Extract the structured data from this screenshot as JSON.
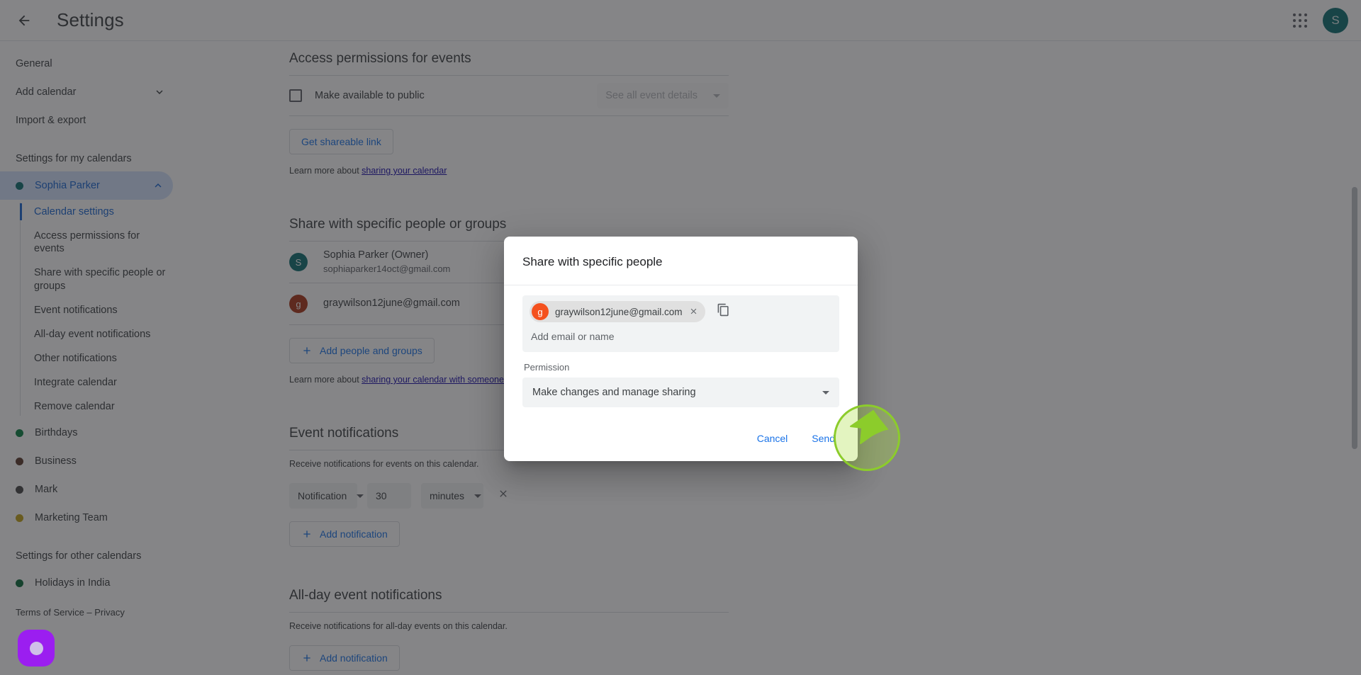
{
  "appbar": {
    "back_icon": "arrow-left-icon",
    "title": "Settings",
    "apps_icon": "apps-grid-icon",
    "avatar_initial": "S"
  },
  "sidebar": {
    "top_items": [
      {
        "label": "General",
        "icon": null
      },
      {
        "label": "Add calendar",
        "icon": "chevron-down-icon"
      },
      {
        "label": "Import & export",
        "icon": null
      }
    ],
    "my_calendars_label": "Settings for my calendars",
    "my_calendar": {
      "name": "Sophia Parker",
      "color": "#0f6f72",
      "expanded_icon": "chevron-up-icon",
      "sub_items": [
        {
          "label": "Calendar settings",
          "active": true
        },
        {
          "label": "Access permissions for events",
          "active": false
        },
        {
          "label": "Share with specific people or groups",
          "active": false
        },
        {
          "label": "Event notifications",
          "active": false
        },
        {
          "label": "All-day event notifications",
          "active": false
        },
        {
          "label": "Other notifications",
          "active": false
        },
        {
          "label": "Integrate calendar",
          "active": false
        },
        {
          "label": "Remove calendar",
          "active": false
        }
      ]
    },
    "other_calendars_of_mine": [
      {
        "label": "Birthdays",
        "color": "#0b8043"
      },
      {
        "label": "Business",
        "color": "#5c3a2e"
      },
      {
        "label": "Mark",
        "color": "#484848"
      },
      {
        "label": "Marketing Team",
        "color": "#c0a31a"
      }
    ],
    "other_calendars_label": "Settings for other calendars",
    "other_calendars": [
      {
        "label": "Holidays in India",
        "color": "#0b6b3a"
      }
    ],
    "footer": "Terms of Service – Privacy"
  },
  "main": {
    "access_permissions": {
      "title": "Access permissions for events",
      "checkbox_label": "Make available to public",
      "checkbox_checked": false,
      "details_select": "See all event details",
      "shareable_link_button": "Get shareable link",
      "learn_prefix": "Learn more about ",
      "learn_link": "sharing your calendar"
    },
    "share_section": {
      "title": "Share with specific people or groups",
      "people": [
        {
          "avatar_initial": "S",
          "avatar_color": "#0f6f72",
          "name": "Sophia Parker (Owner)",
          "email": "sophiaparker14oct@gmail.com"
        },
        {
          "avatar_initial": "g",
          "avatar_color": "#a8361a",
          "name": "graywilson12june@gmail.com",
          "email": ""
        }
      ],
      "add_button": "Add people and groups",
      "learn_prefix": "Learn more about ",
      "learn_link": "sharing your calendar with someone"
    },
    "event_notifications": {
      "title": "Event notifications",
      "description": "Receive notifications for events on this calendar.",
      "row": {
        "type": "Notification",
        "amount": "30",
        "unit": "minutes",
        "remove_icon": "close-icon"
      },
      "add_button": "Add notification"
    },
    "allday_notifications": {
      "title": "All-day event notifications",
      "description": "Receive notifications for all-day events on this calendar.",
      "add_button": "Add notification"
    }
  },
  "dialog": {
    "title": "Share with specific people",
    "chip": {
      "avatar_initial": "g",
      "avatar_color": "#f4511e",
      "text": "graywilson12june@gmail.com",
      "remove_icon": "close-icon"
    },
    "copy_icon": "copy-icon",
    "input_placeholder": "Add email or name",
    "permission_label": "Permission",
    "permission_value": "Make changes and manage sharing",
    "permission_caret": "chevron-down-icon",
    "cancel_label": "Cancel",
    "send_label": "Send"
  },
  "overlay": {
    "cursor_icon": "cursor-arrow-icon",
    "highlight_color": "#8ccc2b",
    "record_bubble_icon": "record-bubble-icon",
    "record_bubble_color": "#9b1ef0"
  }
}
